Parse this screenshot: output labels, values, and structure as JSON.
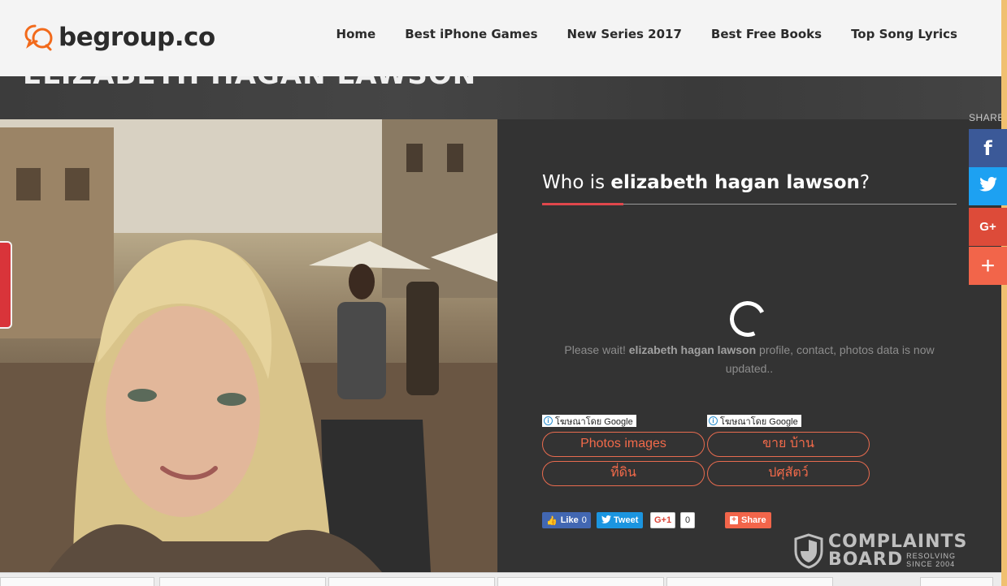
{
  "header": {
    "logo_text": "begroup.co",
    "nav": [
      "Home",
      "Best iPhone Games",
      "New Series 2017",
      "Best Free Books",
      "Top Song Lyrics"
    ]
  },
  "page_title": "ELIZABETH HAGAN LAWSON",
  "panel": {
    "question_prefix": "Who is ",
    "question_name": "elizabeth hagan lawson",
    "question_suffix": "?",
    "wait_prefix": "Please wait! ",
    "wait_name": "elizabeth hagan lawson",
    "wait_suffix": " profile, contact, photos data is now updated.."
  },
  "ads": {
    "label": "โฆษณาโดย Google",
    "buttons": [
      "Photos images",
      "ขาย บ้าน",
      "ที่ดิน",
      "ปศุสัตว์"
    ]
  },
  "social": {
    "like_label": "Like",
    "like_count": "0",
    "tweet_label": "Tweet",
    "gplus_label": "G+1",
    "gplus_count": "0",
    "share_label": "Share"
  },
  "watermark": {
    "line1": "COMPLAINTS",
    "line2": "BOARD",
    "tag1": "RESOLVING",
    "tag2": "SINCE 2004"
  },
  "share_sidebar": {
    "label": "SHARE",
    "buttons": [
      "facebook",
      "twitter",
      "google-plus",
      "more"
    ]
  },
  "colors": {
    "accent": "#e0474c",
    "ad_button": "#f26a4a",
    "panel_bg": "#333333",
    "facebook": "#3b5998",
    "twitter": "#1da1f2",
    "google_plus": "#dd4b39",
    "share_more": "#f2654a"
  }
}
